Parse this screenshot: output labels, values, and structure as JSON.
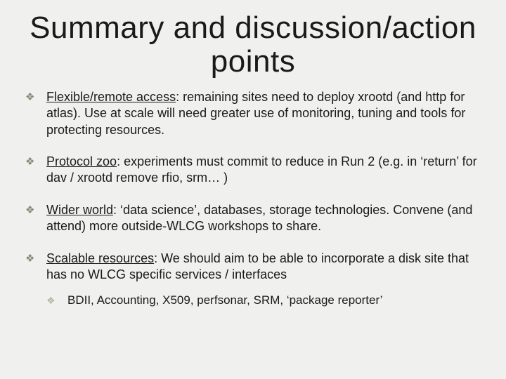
{
  "title": "Summary and discussion/action points",
  "bullets": [
    {
      "lead": "Flexible/remote access",
      "text": ": remaining sites need to deploy xrootd (and http for atlas). Use at scale will need greater use of monitoring, tuning and tools for protecting resources."
    },
    {
      "lead": "Protocol zoo",
      "text": ": experiments must commit to reduce in Run 2 (e.g. in ‘return’ for dav / xrootd remove rfio, srm… )"
    },
    {
      "lead": "Wider world",
      "text": ":  ‘data science’, databases, storage technologies. Convene (and attend) more outside-WLCG workshops to share."
    },
    {
      "lead": "Scalable resources",
      "text": ": We should aim to be able to incorporate a disk site that has no WLCG specific services / interfaces",
      "sub": [
        "BDII, Accounting, X509, perfsonar, SRM, ‘package reporter’"
      ]
    }
  ]
}
